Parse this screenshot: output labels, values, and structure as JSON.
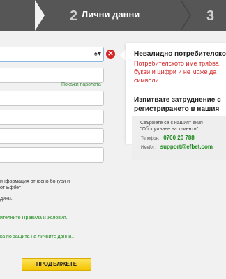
{
  "steps": {
    "step2_number": "2",
    "step2_title": "Лични данни",
    "step3_number": "3"
  },
  "form": {
    "username_value": "",
    "show_password_label": "Покажи паролата",
    "bonus_info_line1": "информация относно бонуси и",
    "bonus_info_line2": "от Ефбет",
    "age_line": "дини.",
    "terms_link": "ителните Правила и Условия.",
    "privacy_link": "ка по защита на личните данни..",
    "submit_label": "ПРОДЪЛЖЕТЕ"
  },
  "help": {
    "error_title": "Невалидно потребителско",
    "error_lines": [
      "Потребителското име трябва",
      "букви и цифри и не може да",
      "символи."
    ],
    "trouble_title_1": "Изпитвате затруднение с",
    "trouble_title_2": "регистрирането в нашия",
    "contact_lead_1": "Свържете се с нашият екип",
    "contact_lead_2": "\"Обслужване на клиенти\":",
    "phone_label": "Телефон:",
    "phone_value": "0700 20 788",
    "email_label": "Имейл :",
    "email_value": "support@efbet.com"
  },
  "colors": {
    "error": "#d42626",
    "link_green": "#1f8a1f",
    "submit_yellow": "#f2c400"
  }
}
